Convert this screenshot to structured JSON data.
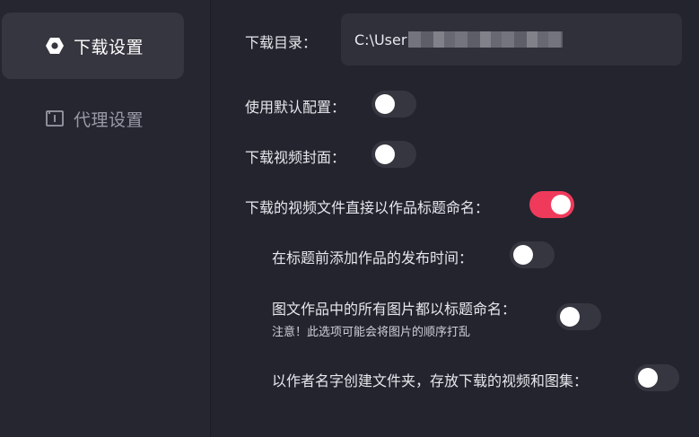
{
  "sidebar": {
    "items": [
      {
        "label": "下载设置",
        "icon": "hexagon-icon",
        "active": true
      },
      {
        "label": "代理设置",
        "icon": "info-box-icon",
        "active": false
      }
    ]
  },
  "settings": {
    "download_dir_label": "下载目录：",
    "download_dir_value": "C:\\User",
    "use_default_label": "使用默认配置：",
    "use_default_on": false,
    "download_cover_label": "下载视频封面：",
    "download_cover_on": false,
    "name_by_title_label": "下载的视频文件直接以作品标题命名：",
    "name_by_title_on": true,
    "add_publish_time_label": "在标题前添加作品的发布时间：",
    "add_publish_time_on": false,
    "images_by_title_label": "图文作品中的所有图片都以标题命名：",
    "images_by_title_note": "注意！此选项可能会将图片的顺序打乱",
    "images_by_title_on": false,
    "author_folder_label": "以作者名字创建文件夹，存放下载的视频和图集：",
    "author_folder_on": false
  },
  "colors": {
    "accent": "#f03a5c",
    "background": "#24242e",
    "toggle_off": "#363641"
  }
}
